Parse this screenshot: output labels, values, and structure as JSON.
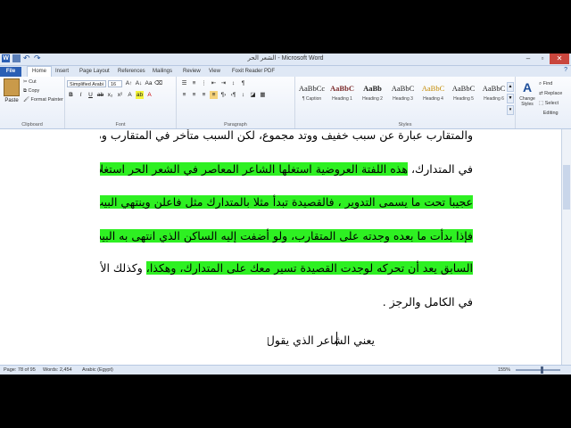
{
  "title_bar": {
    "app_icon": "W",
    "title": "الشعر الحر - Microsoft Word"
  },
  "tabs": [
    {
      "label": "File"
    },
    {
      "label": "Home"
    },
    {
      "label": "Insert"
    },
    {
      "label": "Page Layout"
    },
    {
      "label": "References"
    },
    {
      "label": "Mailings"
    },
    {
      "label": "Review"
    },
    {
      "label": "View"
    },
    {
      "label": "Foxit Reader PDF"
    }
  ],
  "ribbon": {
    "clipboard": {
      "paste": "Paste",
      "cut": "Cut",
      "copy": "Copy",
      "format_painter": "Format Painter",
      "label": "Clipboard"
    },
    "font": {
      "name": "Simplified Arabi",
      "size": "16",
      "label": "Font"
    },
    "paragraph": {
      "label": "Paragraph"
    },
    "styles": {
      "label": "Styles",
      "items": [
        {
          "sample": "AaBbCc",
          "name": "¶ Caption"
        },
        {
          "sample": "AaBbC",
          "name": "Heading 1"
        },
        {
          "sample": "AaBb",
          "name": "Heading 2"
        },
        {
          "sample": "AaBbC",
          "name": "Heading 3"
        },
        {
          "sample": "AaBbC",
          "name": "Heading 4"
        },
        {
          "sample": "AaBbC",
          "name": "Heading 5"
        },
        {
          "sample": "AaBbC",
          "name": "Heading 6"
        }
      ],
      "change_styles": "Change Styles"
    },
    "editing": {
      "find": "Find",
      "replace": "Replace",
      "select": "Select",
      "label": "Editing"
    }
  },
  "document": {
    "lines": [
      "والمتقارب عبارة عن سبب خفيف ووتد مجموع، لكن السبب متأخر في المتقارب ومتقدم",
      "في المتدارك،",
      "هذه اللفتة العروضية استغلها الشاعر المعاصر في الشعر الحر استغلالا",
      "عجيبا تحت ما يسمى التدوير ، فالقصيدة تبدأ مثلا بالمتدارك مثل فاعلن وينتهي البيت،",
      "فإذا بدأت ما بعده وجدته على المتقارب، ولو أضفت إليه الساكن الذي انتهى به البيت",
      "السابق يعد أن تحركه لوجدت القصيدة تسير معك على المتدارك، وهكذا،",
      "وكذلك الأمر",
      "في الكامل والرجز .",
      "يعني الشاعر الذي يقول:"
    ]
  },
  "status_bar": {
    "page": "Page: 78 of 95",
    "words": "Words: 2,454",
    "language": "Arabic (Egypt)",
    "zoom": "155%"
  }
}
